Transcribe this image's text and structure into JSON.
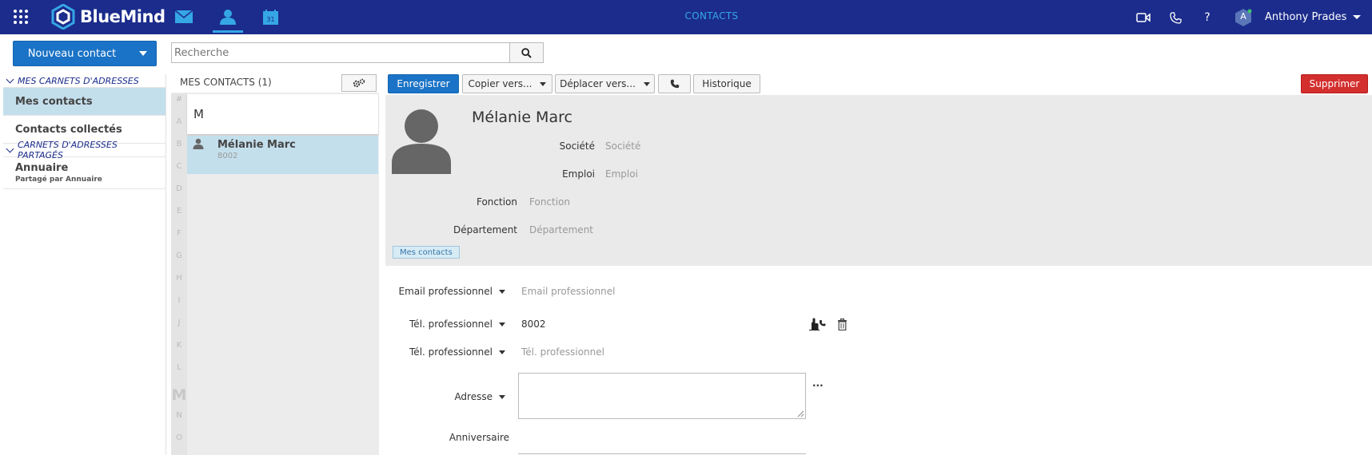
{
  "topbar": {
    "brand": "BlueMind",
    "section_title": "CONTACTS",
    "user_initial": "A",
    "user_name": "Anthony Prades"
  },
  "toolbar": {
    "new_contact_label": "Nouveau contact",
    "search_placeholder": "Recherche"
  },
  "sidebar": {
    "my_books_header": "MES CARNETS D'ADRESSES",
    "items": [
      {
        "label": "Mes contacts",
        "active": true
      },
      {
        "label": "Contacts collectés",
        "active": false
      }
    ],
    "shared_header": "CARNETS D'ADRESSES PARTAGÉS",
    "shared_items": [
      {
        "label": "Annuaire",
        "sub": "Partagé par Annuaire"
      }
    ]
  },
  "list": {
    "title": "MES CONTACTS (1)",
    "alphabet": [
      "#",
      "A",
      "B",
      "C",
      "D",
      "E",
      "F",
      "G",
      "H",
      "I",
      "J",
      "K",
      "L",
      "M",
      "N",
      "O"
    ],
    "current_letter": "M",
    "group_letter": "M",
    "contacts": [
      {
        "name": "Mélanie Marc",
        "number": "8002"
      }
    ]
  },
  "detail": {
    "buttons": {
      "save": "Enregistrer",
      "copy": "Copier vers...",
      "move": "Déplacer vers...",
      "history": "Historique",
      "delete": "Supprimer"
    },
    "name": "Mélanie Marc",
    "fields": {
      "company_label": "Société",
      "company_placeholder": "Société",
      "job_label": "Emploi",
      "job_placeholder": "Emploi",
      "function_label": "Fonction",
      "function_placeholder": "Fonction",
      "department_label": "Département",
      "department_placeholder": "Département"
    },
    "tag": "Mes contacts",
    "email_label": "Email professionnel",
    "email_placeholder": "Email professionnel",
    "phone1_label": "Tél. professionnel",
    "phone1_value": "8002",
    "phone2_label": "Tél. professionnel",
    "phone2_placeholder": "Tél. professionnel",
    "address_label": "Adresse",
    "address_more": "...",
    "birthday_label": "Anniversaire"
  },
  "colors": {
    "topbar": "#1b2c8c",
    "accent": "#35a7e4",
    "primary_button": "#1a73c6",
    "danger_button": "#d32f2f",
    "selection": "#c4dfec"
  }
}
